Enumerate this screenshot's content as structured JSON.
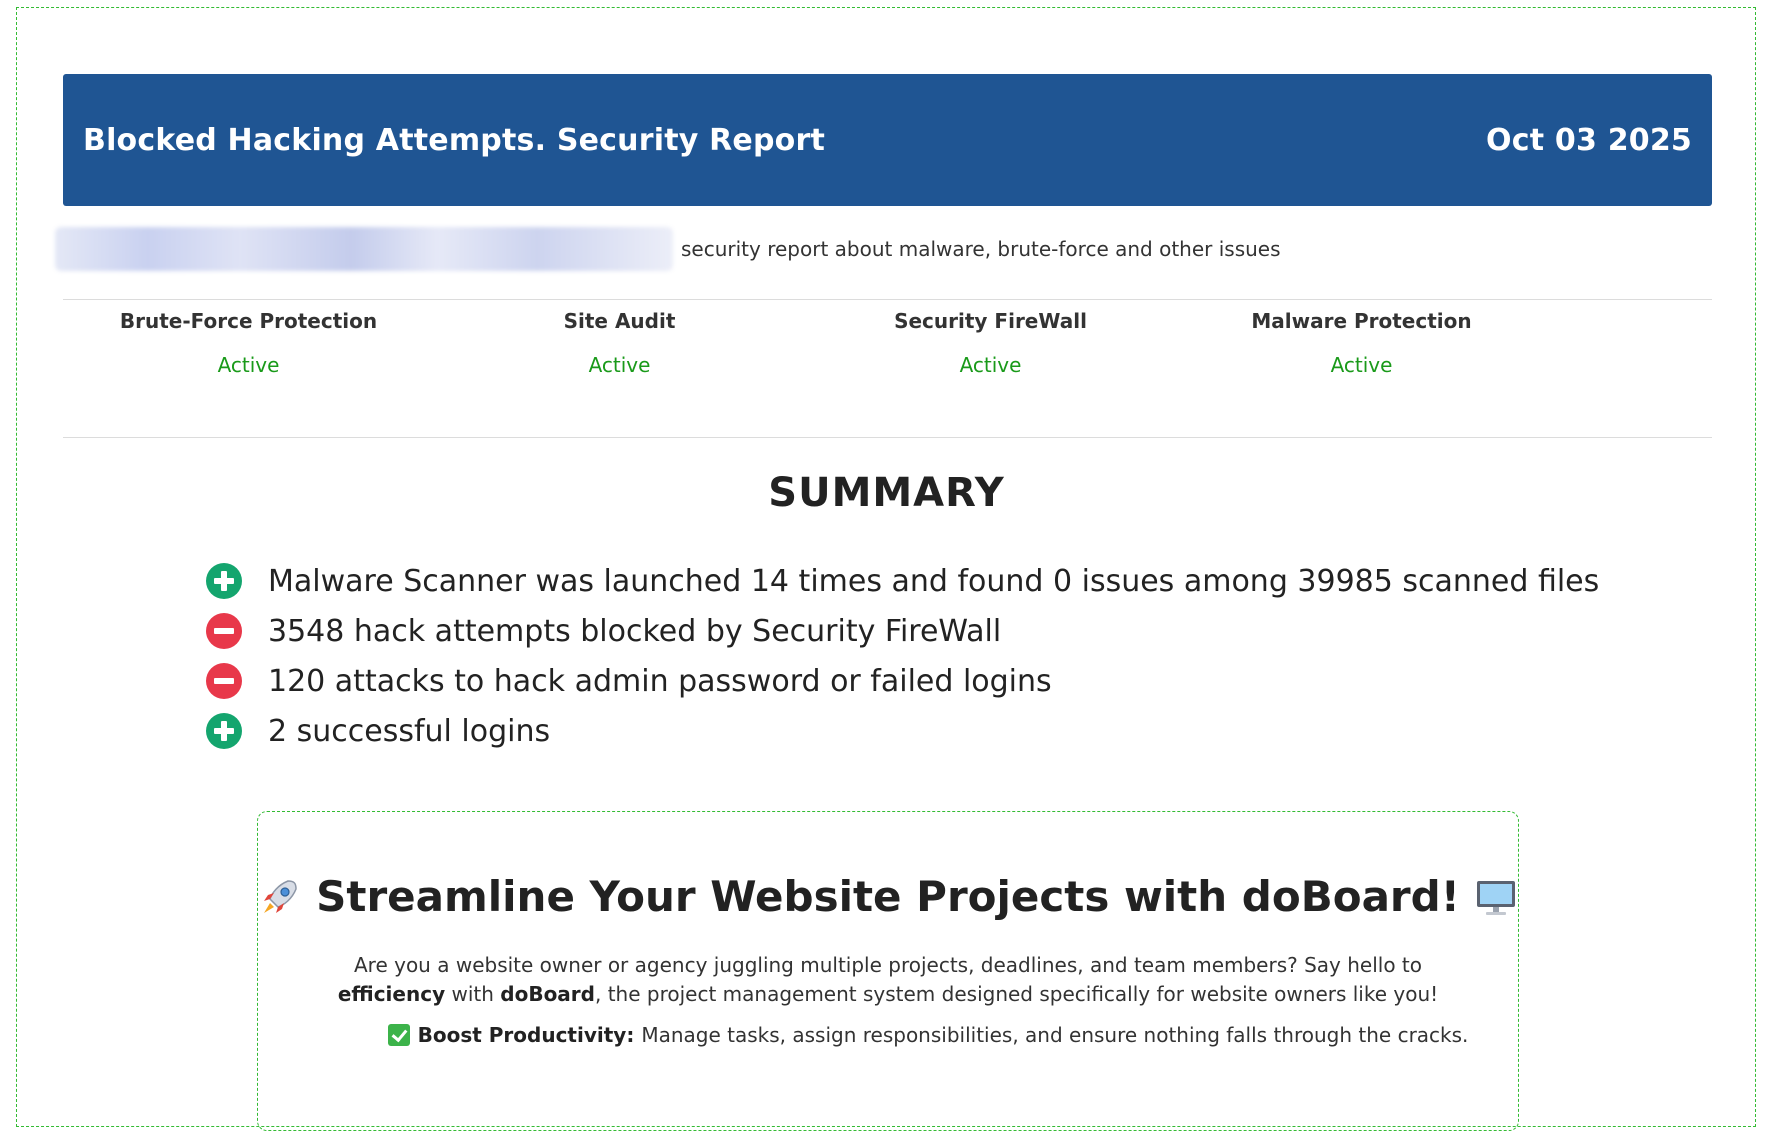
{
  "header": {
    "title": "Blocked Hacking Attempts. Security Report",
    "date": "Oct 03 2025"
  },
  "intro": {
    "text": "security report about malware, brute-force and other issues"
  },
  "statuses": [
    {
      "name": "Brute-Force Protection",
      "value": "Active"
    },
    {
      "name": "Site Audit",
      "value": "Active"
    },
    {
      "name": "Security FireWall",
      "value": "Active"
    },
    {
      "name": "Malware Protection",
      "value": "Active"
    }
  ],
  "summary": {
    "title": "SUMMARY",
    "items": [
      {
        "icon": "plus-circle-icon",
        "text": "Malware Scanner was launched 14 times and found 0 issues among 39985 scanned files"
      },
      {
        "icon": "minus-circle-icon",
        "text": "3548 hack attempts blocked by Security FireWall"
      },
      {
        "icon": "minus-circle-icon",
        "text": "120 attacks to hack admin password or failed logins"
      },
      {
        "icon": "plus-circle-icon",
        "text": "2 successful logins"
      }
    ]
  },
  "promo": {
    "title": "Streamline Your Website Projects with doBoard!",
    "text_1": "Are you a website owner or agency juggling multiple projects, deadlines, and team members? Say hello to ",
    "text_bold_1": "efficiency",
    "text_2": " with ",
    "text_bold_2": "doBoard",
    "text_3": ", the project management system designed specifically for website owners like you!",
    "point_label": "Boost Productivity:",
    "point_text": "Manage tasks, assign responsibilities, and ensure nothing falls through the cracks."
  },
  "colors": {
    "header_bg": "#1f5593",
    "active": "#1a9a1a",
    "plus_icon": "#14a56e",
    "minus_icon": "#e8384a"
  }
}
